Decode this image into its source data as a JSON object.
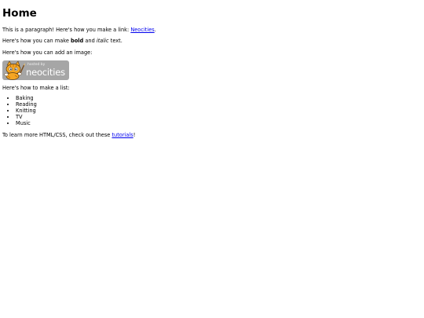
{
  "heading": "Home",
  "para1": {
    "text": "This is a paragraph! Here's how you make a link: ",
    "link": "Neocities",
    "end": "."
  },
  "para2": {
    "before": "Here's how you can make ",
    "bold": "bold",
    "mid": " and ",
    "italic": "italic",
    "after": " text."
  },
  "para3": "Here's how you can add an image:",
  "badge": {
    "small_text": "hosted by",
    "big_text": "neocities",
    "background": "#a6a6a6",
    "cat_color": "#f5a623",
    "icon": "neocities-cat-logo"
  },
  "para4": "Here's how to make a list:",
  "list": [
    "Baking",
    "Reading",
    "Knitting",
    "TV",
    "Music"
  ],
  "para5": {
    "text": "To learn more HTML/CSS, check out these ",
    "link": "tutorials",
    "end": "!"
  },
  "colors": {
    "link": "#0000ee",
    "text": "#000000",
    "background": "#ffffff"
  }
}
